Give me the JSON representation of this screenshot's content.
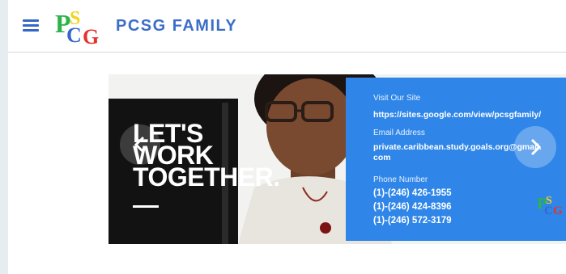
{
  "site": {
    "title": "PCSG FAMILY"
  },
  "hero": {
    "overlay_lines": [
      "LET'S",
      "WORK",
      "TOGETHER."
    ]
  },
  "contact": {
    "site_label": "Visit Our Site",
    "site_url": "https://sites.google.com/view/pcsgfamily/",
    "email_label": "Email Address",
    "email_line1": "private.caribbean.study.goals.org@gmail.",
    "email_line2": "com",
    "phone_label": "Phone Number",
    "phones": [
      "(1)-(246) 426-1955",
      "(1)-(246) 424-8396",
      "(1)-(246) 572-3179"
    ]
  },
  "icons": {
    "menu": "hamburger-menu-icon",
    "prev": "chevron-left-icon",
    "next": "chevron-right-icon"
  },
  "colors": {
    "brand_blue": "#3c6ec8",
    "panel_blue": "#2f86e8",
    "logo_green": "#2cb34a",
    "logo_yellow": "#f4d21e",
    "logo_red": "#e5322b"
  }
}
